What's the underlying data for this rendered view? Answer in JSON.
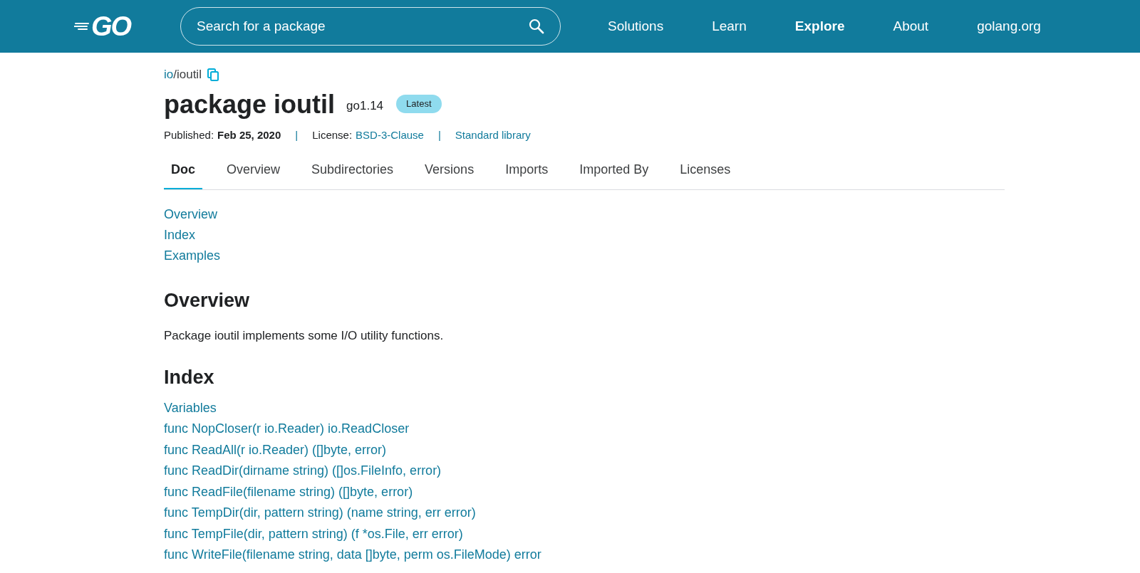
{
  "header": {
    "logo": "GO",
    "search": {
      "placeholder": "Search for a package"
    },
    "nav": [
      {
        "label": "Solutions",
        "selected": false
      },
      {
        "label": "Learn",
        "selected": false
      },
      {
        "label": "Explore",
        "selected": true
      },
      {
        "label": "About",
        "selected": false
      },
      {
        "label": "golang.org",
        "selected": false
      }
    ]
  },
  "breadcrumb": {
    "parent": "io",
    "current": "/ioutil"
  },
  "title": "package ioutil",
  "version": "go1.14",
  "badge": "Latest",
  "meta": [
    {
      "kind": "label",
      "label": "Published:",
      "value": "Feb 25, 2020"
    },
    {
      "kind": "sep",
      "label": "|"
    },
    {
      "kind": "label",
      "label": "License:",
      "value": "BSD-3-Clause"
    },
    {
      "kind": "sep",
      "label": "|"
    },
    {
      "kind": "link",
      "label": "Standard library"
    }
  ],
  "tabs": [
    {
      "label": "Doc",
      "selected": true
    },
    {
      "label": "Overview",
      "selected": false
    },
    {
      "label": "Subdirectories",
      "selected": false
    },
    {
      "label": "Versions",
      "selected": false
    },
    {
      "label": "Imports",
      "selected": false
    },
    {
      "label": "Imported By",
      "selected": false
    },
    {
      "label": "Licenses",
      "selected": false
    }
  ],
  "toc": [
    "Overview",
    "Index",
    "Examples"
  ],
  "overview": {
    "heading": "Overview",
    "text": "Package ioutil implements some I/O utility functions."
  },
  "index": {
    "heading": "Index",
    "items": [
      "Variables",
      "func NopCloser(r io.Reader) io.ReadCloser",
      "func ReadAll(r io.Reader) ([]byte, error)",
      "func ReadDir(dirname string) ([]os.FileInfo, error)",
      "func ReadFile(filename string) ([]byte, error)",
      "func TempDir(dir, pattern string) (name string, err error)",
      "func TempFile(dir, pattern string) (f *os.File, err error)",
      "func WriteFile(filename string, data []byte, perm os.FileMode) error"
    ]
  }
}
